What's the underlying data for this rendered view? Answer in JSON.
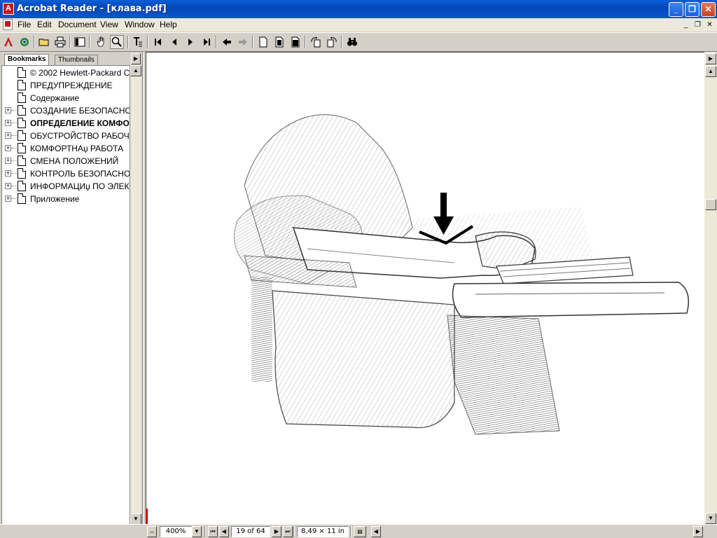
{
  "window": {
    "title": "Acrobat Reader - [клава.pdf]"
  },
  "menu": {
    "items": [
      "File",
      "Edit",
      "Document",
      "View",
      "Window",
      "Help"
    ]
  },
  "toolbar": {
    "icons": [
      "acrobat-logo-icon",
      "go-online-icon",
      "open-icon",
      "print-icon",
      "show-navigation-pane-icon",
      "hand-tool-icon",
      "zoom-tool-icon",
      "text-select-tool-icon",
      "first-page-icon",
      "previous-page-icon",
      "next-page-icon",
      "last-page-icon",
      "go-back-icon",
      "go-forward-icon",
      "actual-size-icon",
      "fit-page-icon",
      "fit-width-icon",
      "rotate-left-icon",
      "rotate-right-icon",
      "find-icon"
    ]
  },
  "navpanel": {
    "tabs": [
      "Bookmarks",
      "Thumbnails"
    ],
    "bookmarks": [
      {
        "label": "© 2002 Hewlett-Packard C",
        "expandable": false,
        "bold": false
      },
      {
        "label": "ПРЕДУПРЕЖДЕНИЕ",
        "expandable": false,
        "bold": false
      },
      {
        "label": "Содержание",
        "expandable": false,
        "bold": false
      },
      {
        "label": "СОЗДАНИЕ БЕЗОПАСНО",
        "expandable": true,
        "bold": false
      },
      {
        "label": "ОПРЕДЕЛЕНИЕ КОМФОР",
        "expandable": true,
        "bold": true
      },
      {
        "label": "ОБУСТРОЙСТВО РАБОЧ",
        "expandable": true,
        "bold": false
      },
      {
        "label": "КОМФОРТНАџ РАБОТА",
        "expandable": true,
        "bold": false
      },
      {
        "label": "СМЕНА ПОЛОЖЕНИЙ",
        "expandable": true,
        "bold": false
      },
      {
        "label": "КОНТРОЛЬ БЕЗОПАСНО",
        "expandable": true,
        "bold": false
      },
      {
        "label": "ИНФОРМАЦИџ ПО ЭЛЕК",
        "expandable": true,
        "bold": false
      },
      {
        "label": "Приложение",
        "expandable": true,
        "bold": false
      }
    ]
  },
  "document": {
    "illustration": "pencil-sketch-of-forearm-resting-on-keyboard-tray-with-arrow"
  },
  "statusbar": {
    "zoom": "400%",
    "page": "19 of 64",
    "page_size": "8,49 × 11 in"
  }
}
